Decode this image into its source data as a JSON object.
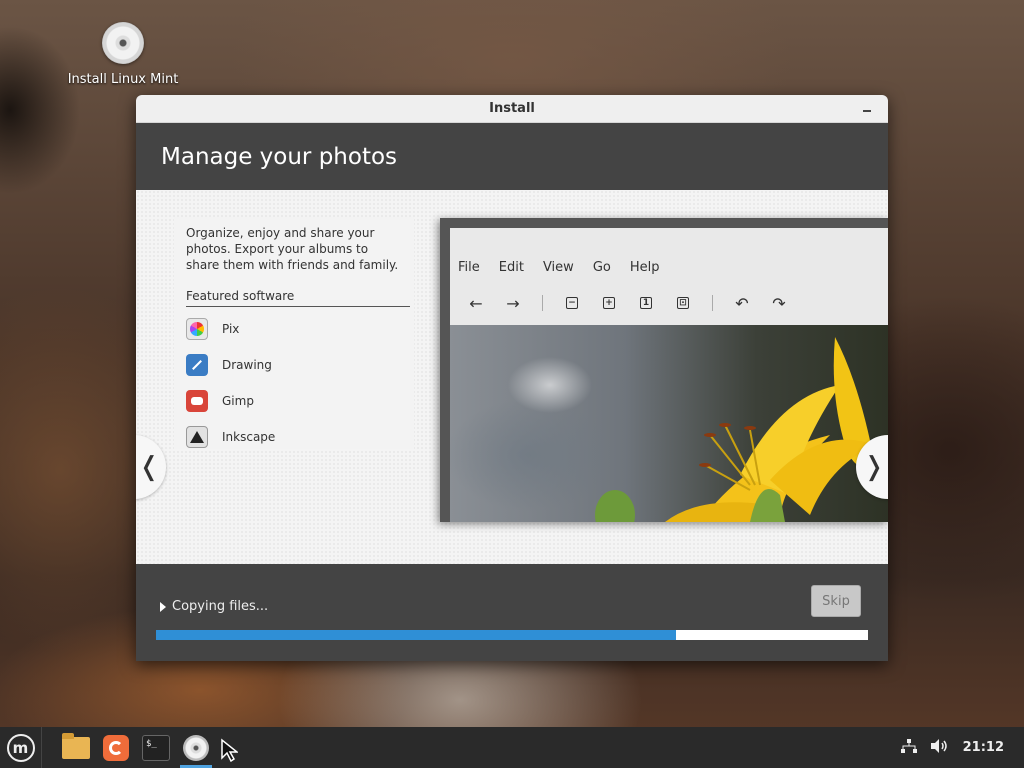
{
  "desktop": {
    "icon_label": "Install Linux Mint"
  },
  "window": {
    "title": "Install",
    "heading": "Manage your photos",
    "description": "Organize, enjoy and share your photos. Export your albums to share them with friends and family.",
    "featured_label": "Featured software",
    "software": [
      {
        "name": "Pix",
        "icon": "pix-icon"
      },
      {
        "name": "Drawing",
        "icon": "drawing-icon"
      },
      {
        "name": "Gimp",
        "icon": "gimp-icon"
      },
      {
        "name": "Inkscape",
        "icon": "inkscape-icon"
      }
    ],
    "screenshot": {
      "menu": [
        "File",
        "Edit",
        "View",
        "Go",
        "Help"
      ],
      "toolbar_box_labels": [
        "−",
        "+",
        "1",
        "⊡"
      ]
    },
    "status": {
      "label": "Copying files...",
      "skip_label": "Skip",
      "progress_percent": 73
    }
  },
  "taskbar": {
    "apps": [
      "files-icon",
      "firefox-icon",
      "terminal-icon",
      "installer-disc-icon"
    ],
    "active_app": "installer-disc-icon",
    "clock": "21:12",
    "tray": [
      "network-icon",
      "volume-icon"
    ]
  },
  "colors": {
    "accent": "#2f8fd6",
    "header_bg": "#444444"
  }
}
